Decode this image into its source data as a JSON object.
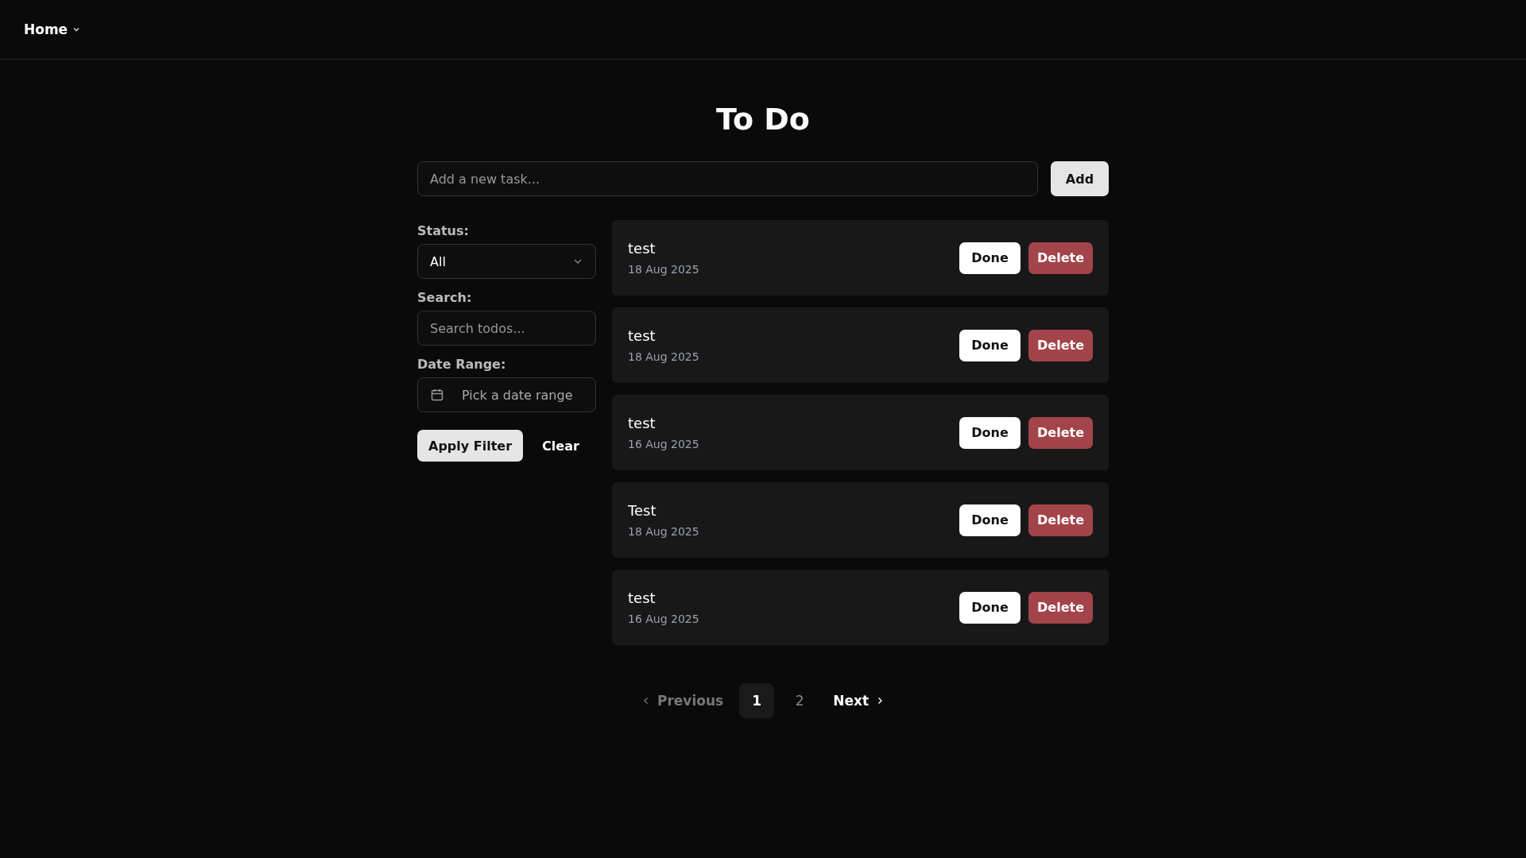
{
  "nav": {
    "label": "Home"
  },
  "title": "To Do",
  "new_task": {
    "placeholder": "Add a new task...",
    "button": "Add"
  },
  "filters": {
    "status_label": "Status:",
    "status_value": "All",
    "search_label": "Search:",
    "search_placeholder": "Search todos...",
    "date_label": "Date Range:",
    "date_placeholder": "Pick a date range",
    "apply": "Apply Filter",
    "clear": "Clear"
  },
  "tasks": [
    {
      "title": "test",
      "date": "18 Aug 2025",
      "done_button": "Done",
      "delete_button": "Delete"
    },
    {
      "title": "test",
      "date": "18 Aug 2025",
      "done_button": "Done",
      "delete_button": "Delete"
    },
    {
      "title": "test",
      "date": "16 Aug 2025",
      "done_button": "Done",
      "delete_button": "Delete"
    },
    {
      "title": "Test",
      "date": "18 Aug 2025",
      "done_button": "Done",
      "delete_button": "Delete"
    },
    {
      "title": "test",
      "date": "16 Aug 2025",
      "done_button": "Done",
      "delete_button": "Delete"
    }
  ],
  "pagination": {
    "previous": {
      "label": "Previous",
      "disabled": true
    },
    "pages": [
      {
        "label": "1",
        "selected": true
      },
      {
        "label": "2",
        "selected": false
      }
    ],
    "next": {
      "label": "Next",
      "disabled": false
    }
  }
}
